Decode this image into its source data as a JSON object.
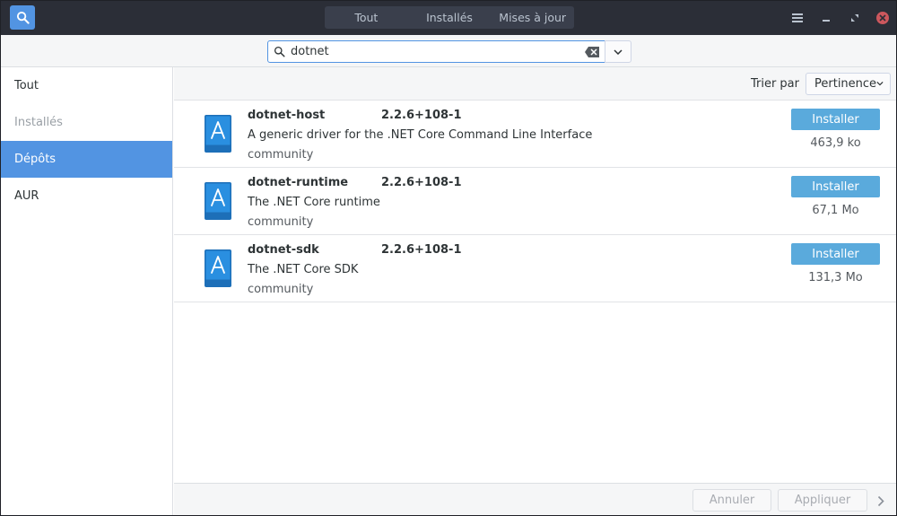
{
  "header": {
    "search_icon": "search-icon",
    "tabs": [
      {
        "label": "Tout"
      },
      {
        "label": "Installés"
      },
      {
        "label": "Mises à jour"
      }
    ],
    "menu_icon": "hamburger-menu-icon",
    "minimize_icon": "minimize-icon",
    "maximize_icon": "maximize-icon",
    "close_icon": "close-icon"
  },
  "search": {
    "value": "dotnet",
    "placeholder": ""
  },
  "sidebar": {
    "items": [
      {
        "label": "Tout",
        "state": "normal"
      },
      {
        "label": "Installés",
        "state": "dim"
      },
      {
        "label": "Dépôts",
        "state": "active"
      },
      {
        "label": "AUR",
        "state": "normal"
      }
    ]
  },
  "sort": {
    "label": "Trier par",
    "selected": "Pertinence"
  },
  "packages": [
    {
      "name": "dotnet-host",
      "version": "2.2.6+108-1",
      "description": "A generic driver for the .NET Core Command Line Interface",
      "repo": "community",
      "action": "Installer",
      "size": "463,9 ko"
    },
    {
      "name": "dotnet-runtime",
      "version": "2.2.6+108-1",
      "description": "The .NET Core runtime",
      "repo": "community",
      "action": "Installer",
      "size": "67,1 Mo"
    },
    {
      "name": "dotnet-sdk",
      "version": "2.2.6+108-1",
      "description": "The .NET Core SDK",
      "repo": "community",
      "action": "Installer",
      "size": "131,3 Mo"
    }
  ],
  "bottom": {
    "cancel_label": "Annuler",
    "apply_label": "Appliquer"
  },
  "colors": {
    "accent": "#5294e2",
    "install_button": "#5aaadc",
    "headerbar": "#2b2e37",
    "close": "#cc575d"
  }
}
